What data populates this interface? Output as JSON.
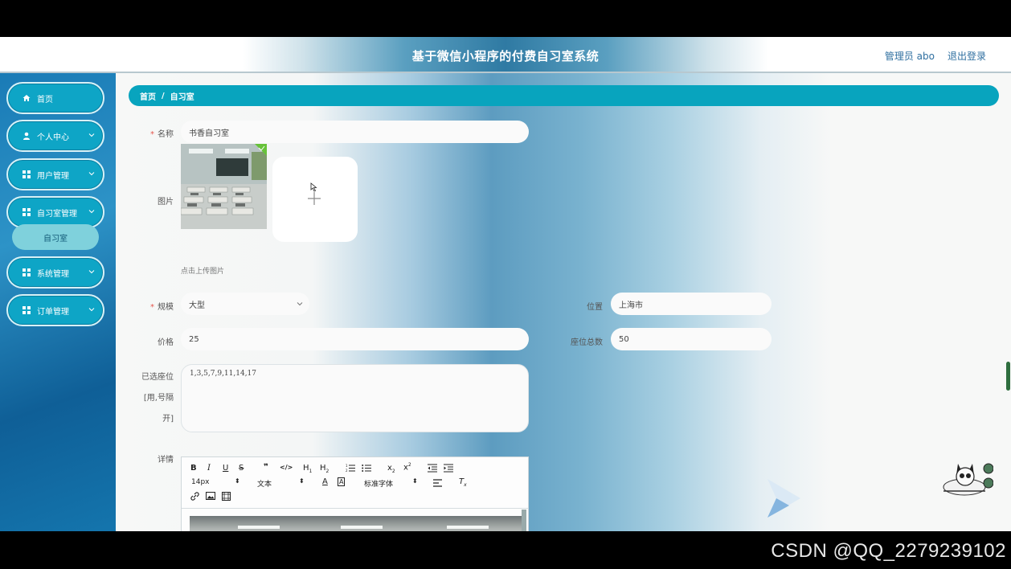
{
  "watermark": "CSDN @QQ_2279239102",
  "header": {
    "title": "基于微信小程序的付费自习室系统",
    "user": "管理员 abo",
    "logout": "退出登录"
  },
  "sidebar": {
    "items": [
      {
        "label": "首页",
        "icon": "home-icon"
      },
      {
        "label": "个人中心",
        "icon": "user-icon"
      },
      {
        "label": "用户管理",
        "icon": "grid-icon"
      },
      {
        "label": "自习室管理",
        "icon": "grid-icon"
      },
      {
        "label": "系统管理",
        "icon": "grid-icon"
      },
      {
        "label": "订单管理",
        "icon": "grid-icon"
      }
    ],
    "subitem": "自习室"
  },
  "breadcrumb": {
    "home": "首页",
    "sep": "/",
    "current": "自习室"
  },
  "form": {
    "name_label": "名称",
    "name_value": "书香自习室",
    "image_label": "图片",
    "upload_hint": "点击上传图片",
    "scale_label": "规模",
    "scale_value": "大型",
    "location_label": "位置",
    "location_value": "上海市",
    "price_label": "价格",
    "price_value": "25",
    "seats_label": "座位总数",
    "seats_value": "50",
    "selected_label_1": "已选座位",
    "selected_label_2": "[用,号隔",
    "selected_label_3": "开]",
    "selected_value": "1,3,5,7,9,11,14,17",
    "detail_label": "详情"
  },
  "editor": {
    "font_size": "14px",
    "text_style": "文本",
    "font_family": "标准字体"
  },
  "colors": {
    "accent": "#08a4be",
    "nav": "#0ea5c6",
    "sidebar": "#1a7bb6"
  }
}
